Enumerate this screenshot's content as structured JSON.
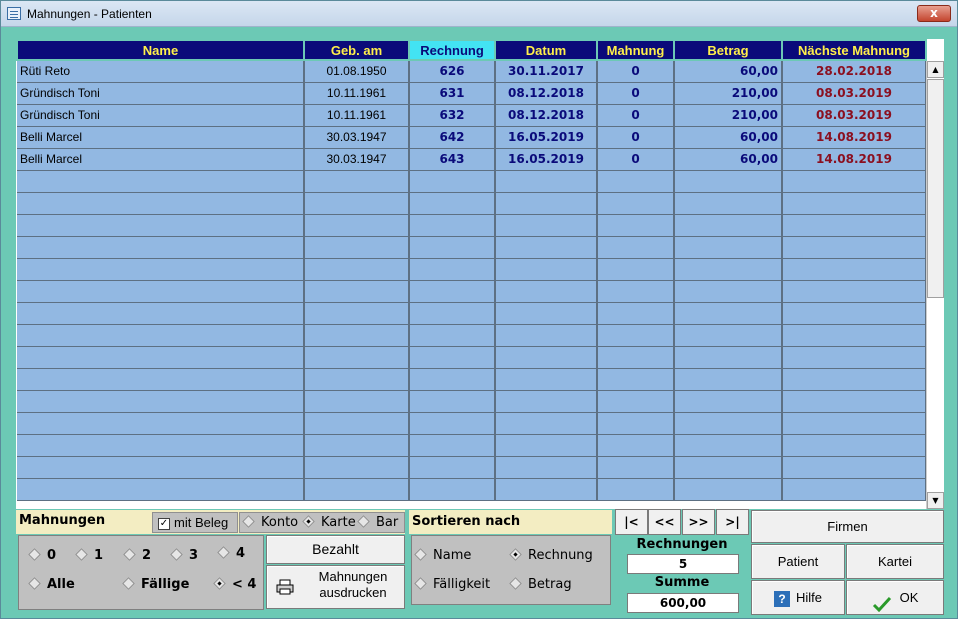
{
  "window": {
    "title": "Mahnungen - Patienten",
    "close_glyph": "x"
  },
  "grid": {
    "columns": [
      "Name",
      "Geb. am",
      "Rechnung",
      "Datum",
      "Mahnung",
      "Betrag",
      "Nächste Mahnung"
    ],
    "active_column": "Rechnung",
    "rows": [
      [
        "Rüti Reto",
        "01.08.1950",
        "626",
        "30.11.2017",
        "0",
        "60,00",
        "28.02.2018"
      ],
      [
        "Gründisch Toni",
        "10.11.1961",
        "631",
        "08.12.2018",
        "0",
        "210,00",
        "08.03.2019"
      ],
      [
        "Gründisch Toni",
        "10.11.1961",
        "632",
        "08.12.2018",
        "0",
        "210,00",
        "08.03.2019"
      ],
      [
        "Belli Marcel",
        "30.03.1947",
        "642",
        "16.05.2019",
        "0",
        "60,00",
        "14.08.2019"
      ],
      [
        "Belli Marcel",
        "30.03.1947",
        "643",
        "16.05.2019",
        "0",
        "60,00",
        "14.08.2019"
      ]
    ],
    "empty_rows": 15
  },
  "mahnungen": {
    "header": "Mahnungen",
    "mit_beleg": {
      "label": "mit Beleg",
      "checked": true
    },
    "payment": [
      {
        "label": "Konto",
        "selected": false
      },
      {
        "label": "Karte",
        "selected": true
      },
      {
        "label": "Bar",
        "selected": false
      }
    ],
    "levels": [
      {
        "label": "0",
        "selected": false
      },
      {
        "label": "1",
        "selected": false
      },
      {
        "label": "2",
        "selected": false
      },
      {
        "label": "3",
        "selected": false
      },
      {
        "label": "4",
        "selected": false
      }
    ],
    "filters": [
      {
        "label": "Alle",
        "selected": false
      },
      {
        "label": "Fällige",
        "selected": false
      },
      {
        "label": "< 4",
        "selected": true
      }
    ],
    "bezahlt_label": "Bezahlt",
    "print_label_1": "Mahnungen",
    "print_label_2": "ausdrucken"
  },
  "sort": {
    "header": "Sortieren nach",
    "options": [
      {
        "label": "Name",
        "selected": false
      },
      {
        "label": "Rechnung",
        "selected": true
      },
      {
        "label": "Fälligkeit",
        "selected": false
      },
      {
        "label": "Betrag",
        "selected": false
      }
    ]
  },
  "nav": {
    "first": "|<",
    "prev": "<<",
    "next": ">>",
    "last": ">|"
  },
  "summary": {
    "rechnungen_label": "Rechnungen",
    "rechnungen_value": "5",
    "summe_label": "Summe",
    "summe_value": "600,00"
  },
  "buttons": {
    "firmen": "Firmen",
    "patient": "Patient",
    "kartei": "Kartei",
    "hilfe": "Hilfe",
    "ok": "OK"
  },
  "colors": {
    "background": "#6cc9b5",
    "header_bg": "#0a0a7a",
    "header_text": "#ffef4a",
    "active_header": "#43e3f3",
    "row_bg": "#92b8e2",
    "due_date": "#8b0f1f"
  }
}
